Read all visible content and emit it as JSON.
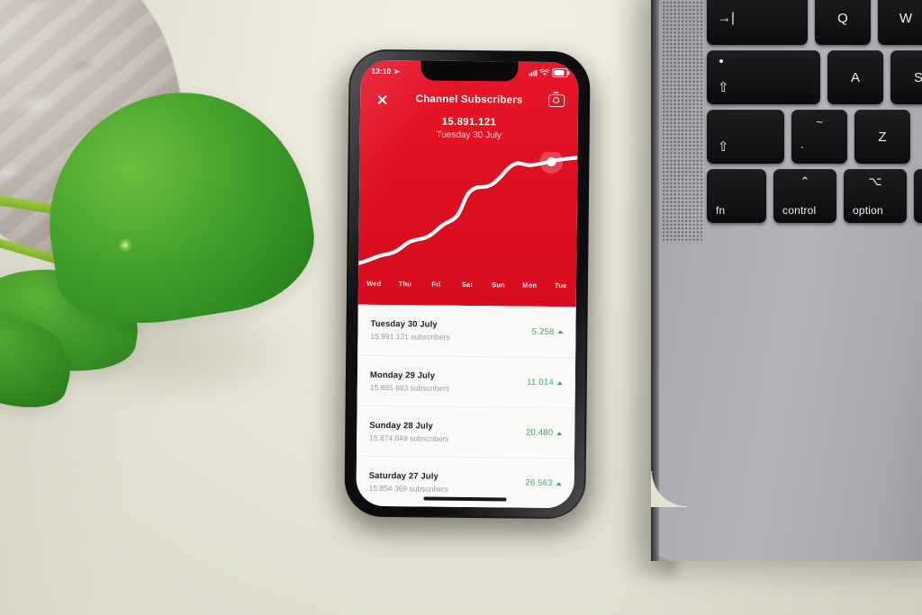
{
  "scene": {
    "description": "Smartphone on desk next to MacBook keyboard with plant",
    "desk_color": "#e9e8da",
    "accent_red": "#e0101f",
    "accent_green": "#3aa86a"
  },
  "phone": {
    "status_bar": {
      "time": "13:10",
      "location_arrow": "location-arrow-icon",
      "signal": "signal-bars-icon",
      "wifi": "wifi-icon",
      "battery": "battery-icon"
    },
    "nav": {
      "close_label": "close-icon",
      "title": "Channel Subscribers",
      "camera_label": "camera-icon"
    },
    "hero": {
      "count": "15.891.121",
      "date": "Tuesday 30 July"
    },
    "home_indicator": "home-indicator"
  },
  "chart_data": {
    "type": "line",
    "title": "Channel Subscribers",
    "subtitle": "Tuesday 30 July",
    "categories": [
      "Wed",
      "Thu",
      "Fri",
      "Sat",
      "Sun",
      "Mon",
      "Tue"
    ],
    "x": [
      "Wed",
      "Thu",
      "Fri",
      "Sat",
      "Sun",
      "Mon",
      "Tue"
    ],
    "series": [
      {
        "name": "Subscribers",
        "values": [
          15760000,
          15790000,
          15812000,
          15828000,
          15854369,
          15874849,
          15885863,
          15891121
        ]
      }
    ],
    "values": [
      15760000,
      15790000,
      15812000,
      15828000,
      15854369,
      15874849,
      15885863,
      15891121
    ],
    "xlabel": "",
    "ylabel": "Subscribers",
    "ylim": [
      15750000,
      15900000
    ],
    "grid": false,
    "legend": "none",
    "line_color": "#ffffff",
    "background_color": "#e0101f",
    "highlight_point": {
      "label": "Tue",
      "value": 15891121,
      "marker": "white-dot-with-halo"
    }
  },
  "list": {
    "rows": [
      {
        "day": "Tuesday 30 July",
        "subscribers": "15.891.121 subscribers",
        "delta": "5.258",
        "trend": "up"
      },
      {
        "day": "Monday 29 July",
        "subscribers": "15.885.863 subscribers",
        "delta": "11.014",
        "trend": "up"
      },
      {
        "day": "Sunday 28 July",
        "subscribers": "15.874.849 subscribers",
        "delta": "20.480",
        "trend": "up"
      },
      {
        "day": "Saturday 27 July",
        "subscribers": "15.854.369 subscribers",
        "delta": "26.563",
        "trend": "up"
      }
    ]
  },
  "laptop": {
    "keys": [
      {
        "name": "tab",
        "label": "→|"
      },
      {
        "name": "q",
        "label": "Q"
      },
      {
        "name": "w",
        "label": "W"
      },
      {
        "name": "capslock",
        "label": "⇧"
      },
      {
        "name": "a",
        "label": "A"
      },
      {
        "name": "s",
        "label": "S"
      },
      {
        "name": "shift",
        "label": "⇧"
      },
      {
        "name": "tilde",
        "label": "~"
      },
      {
        "name": "backtick",
        "label": "`"
      },
      {
        "name": "z",
        "label": "Z"
      },
      {
        "name": "fn",
        "label": "fn"
      },
      {
        "name": "control",
        "label": "control"
      },
      {
        "name": "control_glyph",
        "label": "⌃"
      },
      {
        "name": "option",
        "label": "option"
      },
      {
        "name": "option_glyph",
        "label": "⌥"
      }
    ]
  }
}
